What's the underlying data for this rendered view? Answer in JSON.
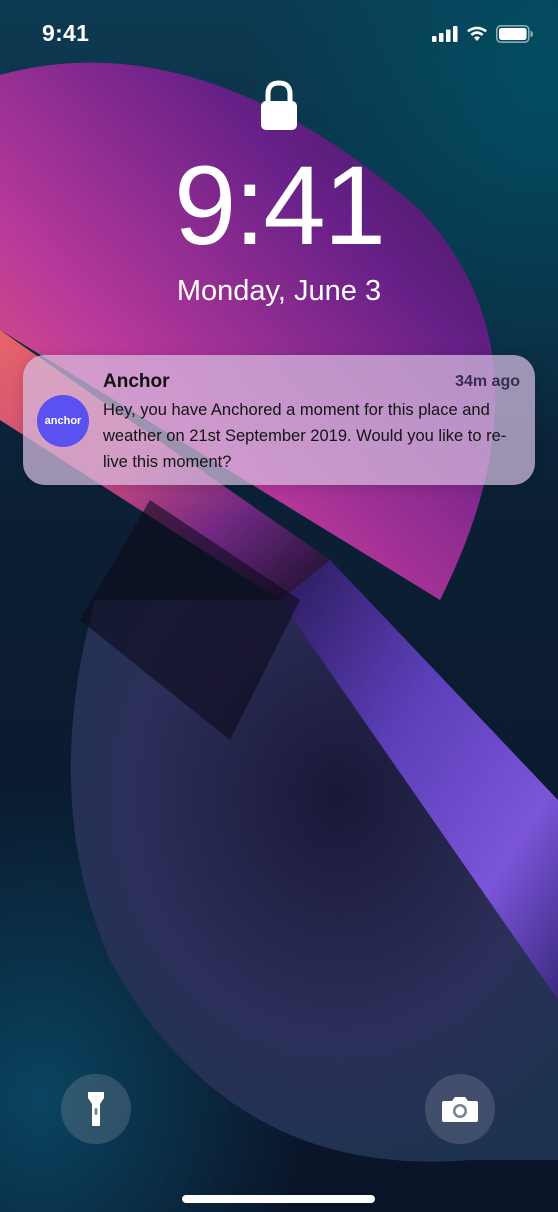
{
  "status_bar": {
    "time": "9:41"
  },
  "lock_screen": {
    "time": "9:41",
    "date": "Monday, June 3"
  },
  "notification": {
    "app_icon_text": "anchor",
    "app_name": "Anchor",
    "time_ago": "34m ago",
    "message": "Hey, you have Anchored a moment for this place and weather on 21st September 2019. Would you like to re-live this moment?",
    "accent_color": "#5b50f0"
  },
  "quick_actions": {
    "left_icon": "flashlight-icon",
    "right_icon": "camera-icon"
  }
}
